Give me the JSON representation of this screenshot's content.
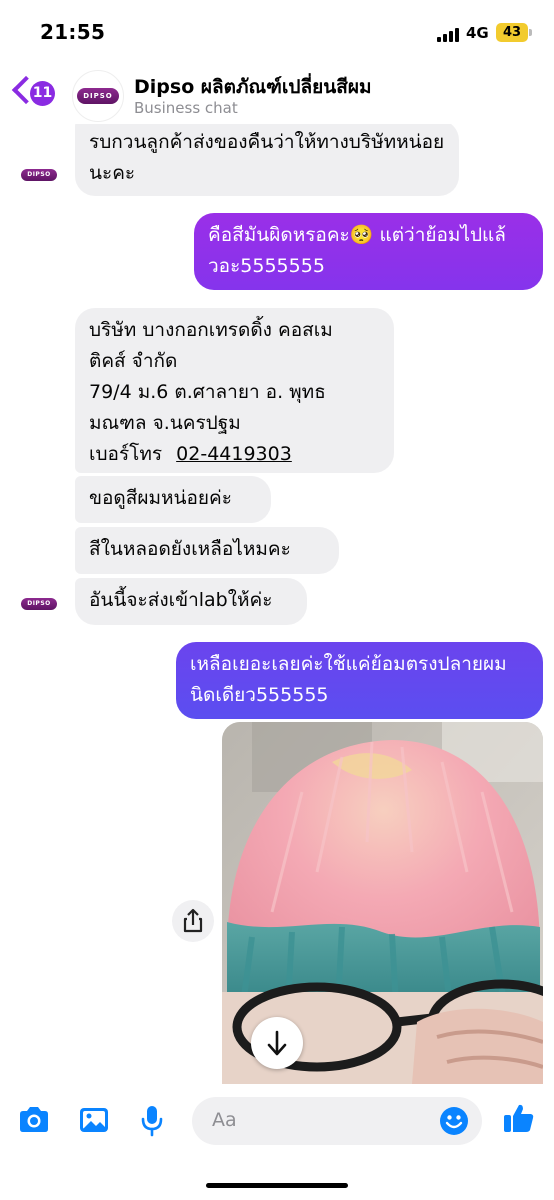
{
  "status_bar": {
    "time": "21:55",
    "network": "4G",
    "battery": "43"
  },
  "header": {
    "back_count": "11",
    "title": "Dipso ผลิตภัณฑ์เปลี่ยนสีผม",
    "subtitle": "Business chat",
    "logo_text": "DIPSO"
  },
  "messages": {
    "m1": "รบกวนลูกค้าส่งของคืนว่าให้ทางบริษัทหน่อยนะคะ",
    "m2": "คือสีมันผิดหรอคะ🥺 แต่ว่าย้อมไปแล้วอะ5555555",
    "m3_line1": "บริษัท  บางกอกเทรดดิ้ง คอสเม",
    "m3_line2": "ติคส์  จำกัด",
    "m3_line3": "79/4 ม.6  ต.ศาลายา  อ. พุทธ",
    "m3_line4": "มณฑล   จ.นครปฐม",
    "m3_phone_label": "เบอร์โทร",
    "m3_phone": "02-4419303",
    "m4": "ขอดูสีผมหน่อยค่ะ",
    "m5": "สีในหลอดยังเหลือไหมคะ",
    "m6": "อันนี้จะส่งเข้าlabให้ค่ะ",
    "m7": "เหลือเยอะเลยค่ะใช้แค่ย้อมตรงปลายผมนิดเดียว555555"
  },
  "composer": {
    "placeholder": "Aa"
  },
  "colors": {
    "accent": "#8a2be2",
    "bubble_out_top": "#9a2fe8",
    "bubble_out_bottom": "#5b4ef0",
    "bubble_in": "#efeff1",
    "icon_blue": "#0a84ff"
  },
  "icons": {
    "camera": "camera-icon",
    "gallery": "image-icon",
    "mic": "microphone-icon",
    "emoji": "emoji-icon",
    "like": "thumbs-up-icon",
    "share": "share-icon",
    "download": "download-icon"
  }
}
